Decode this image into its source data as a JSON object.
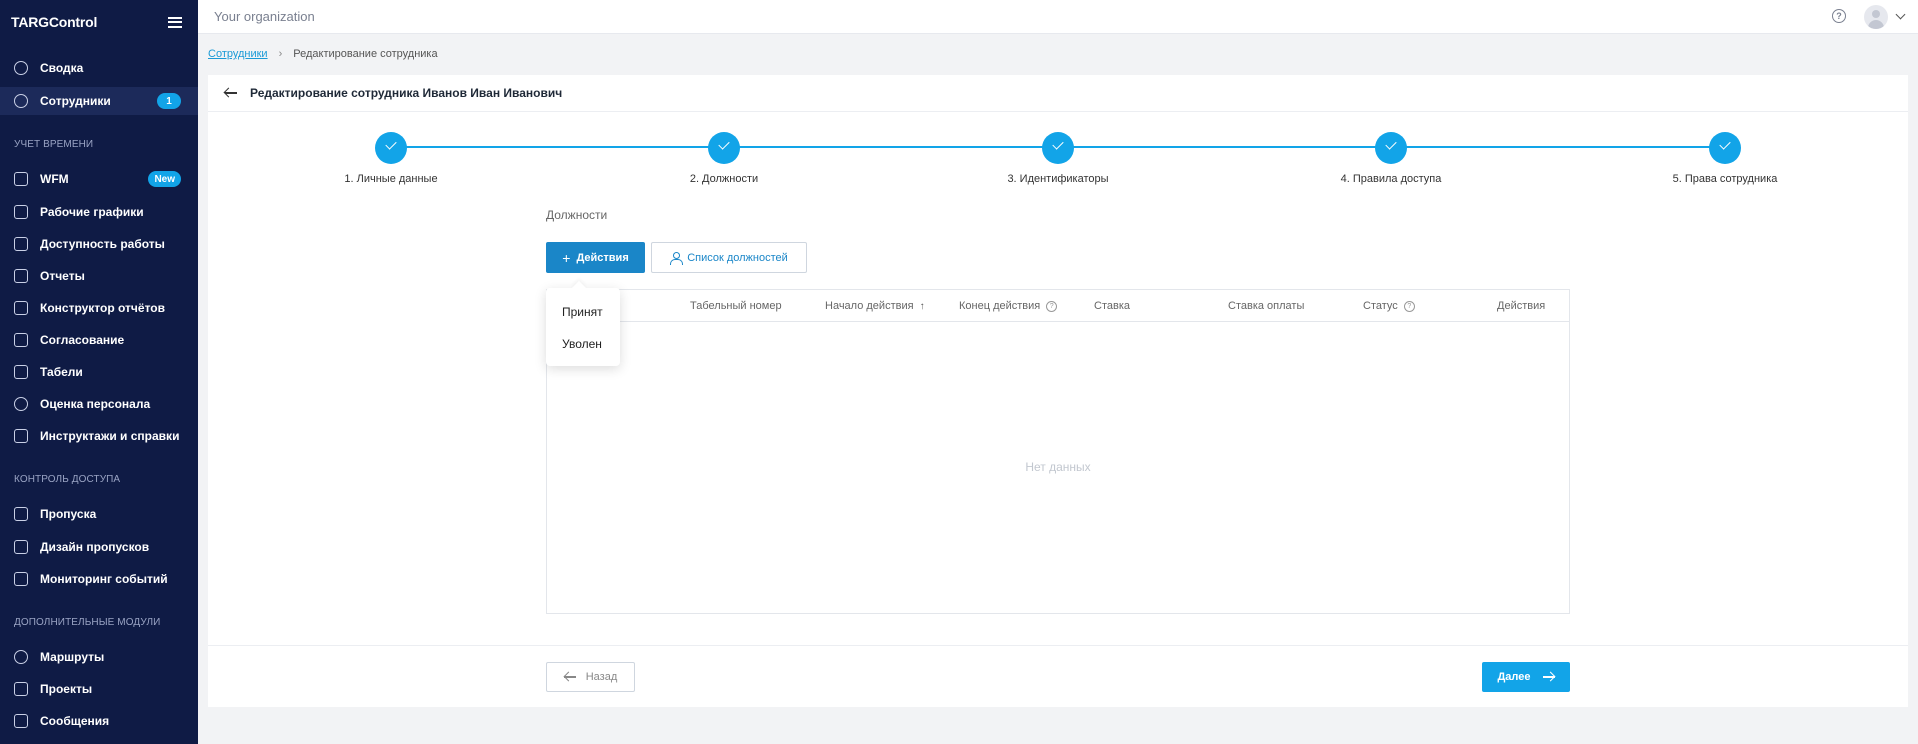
{
  "app": {
    "logo": "TARGControl"
  },
  "topbar": {
    "org": "Your organization",
    "help": "?"
  },
  "sidebar": {
    "items": [
      {
        "label": "Сводка"
      },
      {
        "label": "Сотрудники",
        "badge": "1"
      },
      {
        "label": "WFM",
        "badge": "New"
      },
      {
        "label": "Рабочие графики"
      },
      {
        "label": "Доступность работы"
      },
      {
        "label": "Отчеты"
      },
      {
        "label": "Конструктор отчётов"
      },
      {
        "label": "Согласование"
      },
      {
        "label": "Табели"
      },
      {
        "label": "Оценка персонала"
      },
      {
        "label": "Инструктажи и справки"
      },
      {
        "label": "Пропуска"
      },
      {
        "label": "Дизайн пропусков"
      },
      {
        "label": "Мониторинг событий"
      },
      {
        "label": "Маршруты"
      },
      {
        "label": "Проекты"
      },
      {
        "label": "Сообщения"
      }
    ],
    "sections": [
      "Учет времени",
      "Контроль доступа",
      "Дополнительные модули"
    ]
  },
  "breadcrumb": {
    "link": "Сотрудники",
    "separator": "›",
    "current": "Редактирование сотрудника"
  },
  "page": {
    "title": "Редактирование сотрудника Иванов Иван Иванович"
  },
  "stepper": {
    "steps": [
      {
        "label": "1. Личные данные"
      },
      {
        "label": "2. Должности"
      },
      {
        "label": "3. Идентификаторы"
      },
      {
        "label": "4. Правила доступа"
      },
      {
        "label": "5. Права сотрудника"
      }
    ]
  },
  "positions": {
    "title": "Должности",
    "actions_button": "Действия",
    "actions_plus": "+",
    "list_button": "Список должностей",
    "dropdown": [
      "Принят",
      "Уволен"
    ],
    "columns": [
      "Табельный номер",
      "Начало действия",
      "Конец действия",
      "Ставка",
      "Ставка оплаты",
      "Статус",
      "Действия"
    ],
    "sort_arrow": "↑",
    "empty": "Нет данных"
  },
  "footer": {
    "back": "Назад",
    "next": "Далее"
  },
  "colors": {
    "sidebar_bg": "#0f1b45",
    "accent": "#12a4e8",
    "primary_button": "#1a86c8"
  }
}
